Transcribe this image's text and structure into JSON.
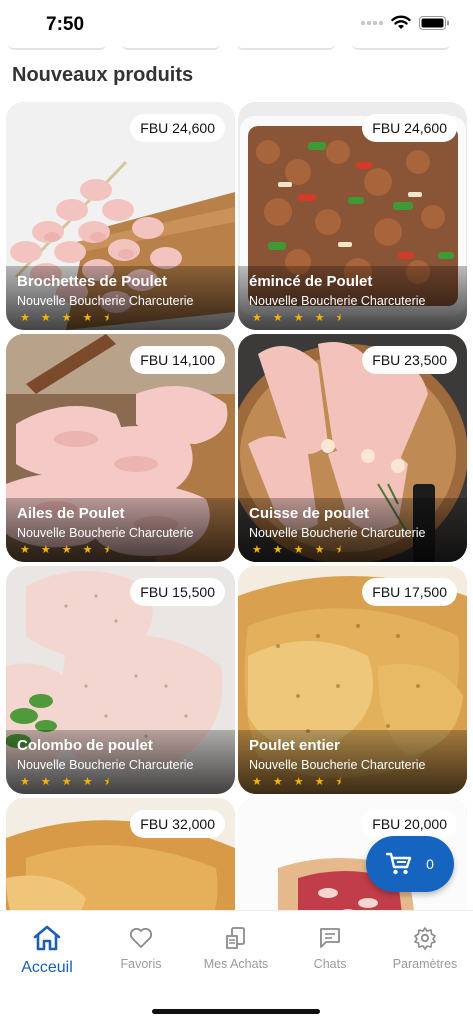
{
  "status_bar": {
    "time": "7:50"
  },
  "section": {
    "title": "Nouveaux produits"
  },
  "products": [
    {
      "name": "Brochettes de Poulet",
      "shop": "Nouvelle Boucherie Charcuterie",
      "price": "FBU 24,600",
      "rating": 4.5
    },
    {
      "name": "émincé de Poulet",
      "shop": "Nouvelle Boucherie Charcuterie",
      "price": "FBU 24,600",
      "rating": 4.5
    },
    {
      "name": "Ailes de Poulet",
      "shop": "Nouvelle Boucherie Charcuterie",
      "price": "FBU 14,100",
      "rating": 4.5
    },
    {
      "name": "Cuisse de poulet",
      "shop": "Nouvelle Boucherie Charcuterie",
      "price": "FBU 23,500",
      "rating": 4.5
    },
    {
      "name": "Colombo de poulet",
      "shop": "Nouvelle Boucherie Charcuterie",
      "price": "FBU 15,500",
      "rating": 4.5
    },
    {
      "name": "Poulet entier",
      "shop": "Nouvelle Boucherie Charcuterie",
      "price": "FBU 17,500",
      "rating": 4.5
    },
    {
      "price": "FBU 32,000"
    },
    {
      "price": "FBU 20,000"
    }
  ],
  "cart": {
    "count": "0",
    "icon": "cart-icon",
    "color": "#1565c0"
  },
  "nav": {
    "active_color": "#1a5fb4",
    "items": [
      {
        "label": "Acceuil",
        "icon": "home-icon"
      },
      {
        "label": "Favoris",
        "icon": "heart-icon"
      },
      {
        "label": "Mes Achats",
        "icon": "receipt-icon"
      },
      {
        "label": "Chats",
        "icon": "chat-icon"
      },
      {
        "label": "Paramètres",
        "icon": "gear-icon"
      }
    ]
  }
}
